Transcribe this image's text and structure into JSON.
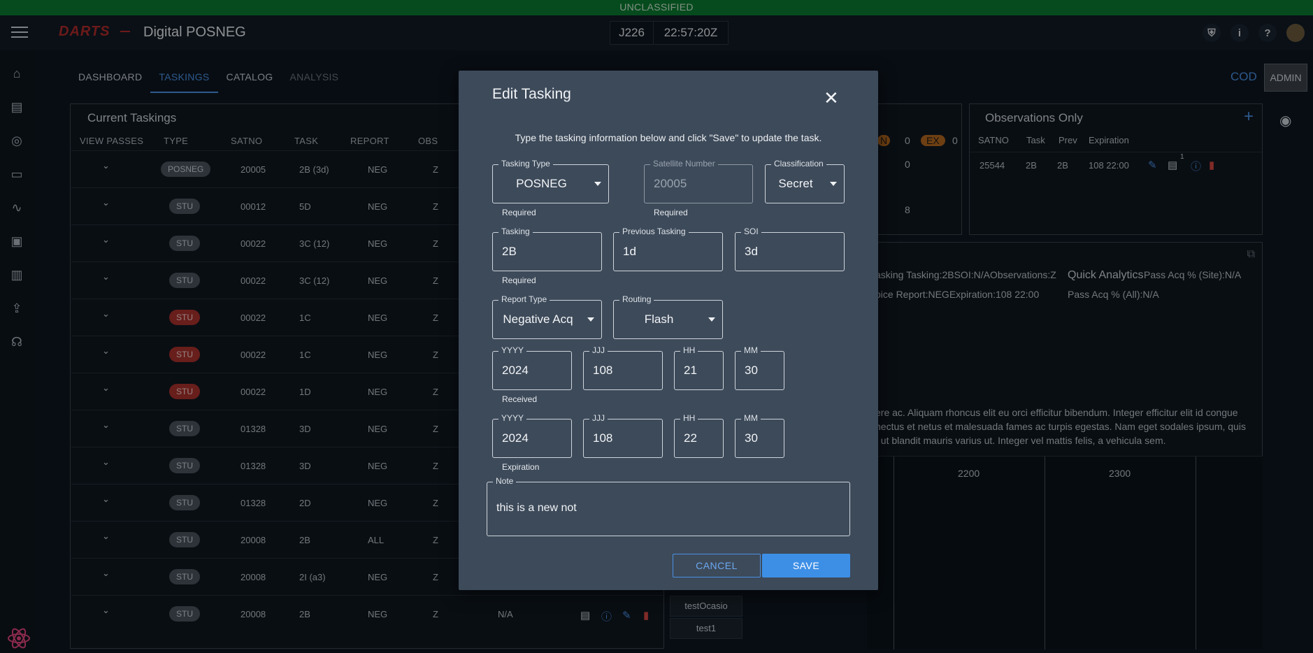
{
  "classification_banner": "UNCLASSIFIED",
  "header": {
    "logo": "DARTS",
    "title": "Digital POSNEG",
    "julian_day": "J226",
    "time": "22:57:20Z"
  },
  "tabs": [
    {
      "label": "DASHBOARD"
    },
    {
      "label": "TASKINGS"
    },
    {
      "label": "CATALOG"
    },
    {
      "label": "ANALYSIS"
    }
  ],
  "top_right": {
    "cod": "COD",
    "admin": "ADMIN"
  },
  "current_taskings": {
    "title": "Current Taskings",
    "columns": [
      "VIEW PASSES",
      "TYPE",
      "SATNO",
      "TASK",
      "REPORT",
      "OBS"
    ],
    "rows": [
      {
        "type": "POSNEG",
        "satno": "20005",
        "task": "2B (3d)",
        "report": "NEG",
        "obs": "Z",
        "red": false
      },
      {
        "type": "STU",
        "satno": "00012",
        "task": "5D",
        "report": "NEG",
        "obs": "Z",
        "red": false
      },
      {
        "type": "STU",
        "satno": "00022",
        "task": "3C (12)",
        "report": "NEG",
        "obs": "Z",
        "red": false
      },
      {
        "type": "STU",
        "satno": "00022",
        "task": "3C (12)",
        "report": "NEG",
        "obs": "Z",
        "red": false
      },
      {
        "type": "STU",
        "satno": "00022",
        "task": "1C",
        "report": "NEG",
        "obs": "Z",
        "red": true
      },
      {
        "type": "STU",
        "satno": "00022",
        "task": "1C",
        "report": "NEG",
        "obs": "Z",
        "red": true
      },
      {
        "type": "STU",
        "satno": "00022",
        "task": "1D",
        "report": "NEG",
        "obs": "Z",
        "red": true
      },
      {
        "type": "STU",
        "satno": "01328",
        "task": "3D",
        "report": "NEG",
        "obs": "Z",
        "red": false
      },
      {
        "type": "STU",
        "satno": "01328",
        "task": "3D",
        "report": "NEG",
        "obs": "Z",
        "red": false
      },
      {
        "type": "STU",
        "satno": "01328",
        "task": "2D",
        "report": "NEG",
        "obs": "Z",
        "red": false
      },
      {
        "type": "STU",
        "satno": "20008",
        "task": "2B",
        "report": "ALL",
        "obs": "Z",
        "red": false
      },
      {
        "type": "STU",
        "satno": "20008",
        "task": "2I (a3)",
        "report": "NEG",
        "obs": "Z",
        "red": false
      },
      {
        "type": "STU",
        "satno": "20008",
        "task": "2B",
        "report": "NEG",
        "obs": "Z",
        "red": false
      }
    ],
    "last_row_extra": "N/A"
  },
  "observations_only": {
    "title": "Observations Only",
    "columns": [
      "SATNO",
      "Task",
      "Prev",
      "Expiration"
    ],
    "row": {
      "satno": "25544",
      "task": "2B",
      "prev": "2B",
      "expiration": "108 22:00",
      "comment_count": "1"
    }
  },
  "background_bits": {
    "ex_label": "EX",
    "n_label": "N",
    "zero1": "0",
    "zero2": "0",
    "zero3": "0",
    "eight": "8",
    "tasking_line": "asking Tasking:2BSOI:N/AObservations:Z",
    "report_line": "oice Report:NEGExpiration:108 22:00",
    "quick_analytics": "Quick Analytics",
    "pass_acq_site": "Pass Acq % (Site):N/A",
    "pass_acq_all": "Pass Acq % (All):N/A",
    "lorem1": "ere ac. Aliquam rhoncus elit eu orci efficitur bibendum. Integer efficitur elit id congue",
    "lorem2": "nectus et netus et malesuada fames ac turpis egestas. Nam eget sodales ipsum, quis",
    "lorem3": ", ut blandit mauris varius ut. Integer vel mattis felis, a vehicula sem.",
    "hour_2200": "2200",
    "hour_2300": "2300",
    "sites": [
      "testOcasio",
      "test1"
    ]
  },
  "modal": {
    "title": "Edit Tasking",
    "intro": "Type the tasking information below and click \"Save\" to update the task.",
    "tasking_type": {
      "label": "Tasking Type",
      "value": "POSNEG",
      "helper": "Required"
    },
    "satellite_number": {
      "label": "Satellite Number",
      "value": "20005",
      "helper": "Required"
    },
    "classification": {
      "label": "Classification",
      "value": "Secret"
    },
    "tasking": {
      "label": "Tasking",
      "value": "2B",
      "helper": "Required"
    },
    "previous_tasking": {
      "label": "Previous Tasking",
      "value": "1d"
    },
    "soi": {
      "label": "SOI",
      "value": "3d"
    },
    "report_type": {
      "label": "Report Type",
      "value": "Negative Acq"
    },
    "routing": {
      "label": "Routing",
      "value": "Flash"
    },
    "received": {
      "yyyy_label": "YYYY",
      "yyyy": "2024",
      "jjj_label": "JJJ",
      "jjj": "108",
      "hh_label": "HH",
      "hh": "21",
      "mm_label": "MM",
      "mm": "30",
      "helper": "Received"
    },
    "expiration": {
      "yyyy_label": "YYYY",
      "yyyy": "2024",
      "jjj_label": "JJJ",
      "jjj": "108",
      "hh_label": "HH",
      "hh": "22",
      "mm_label": "MM",
      "mm": "30",
      "helper": "Expiration"
    },
    "note": {
      "label": "Note",
      "value": "this is a new not"
    },
    "cancel_label": "CANCEL",
    "save_label": "SAVE"
  }
}
